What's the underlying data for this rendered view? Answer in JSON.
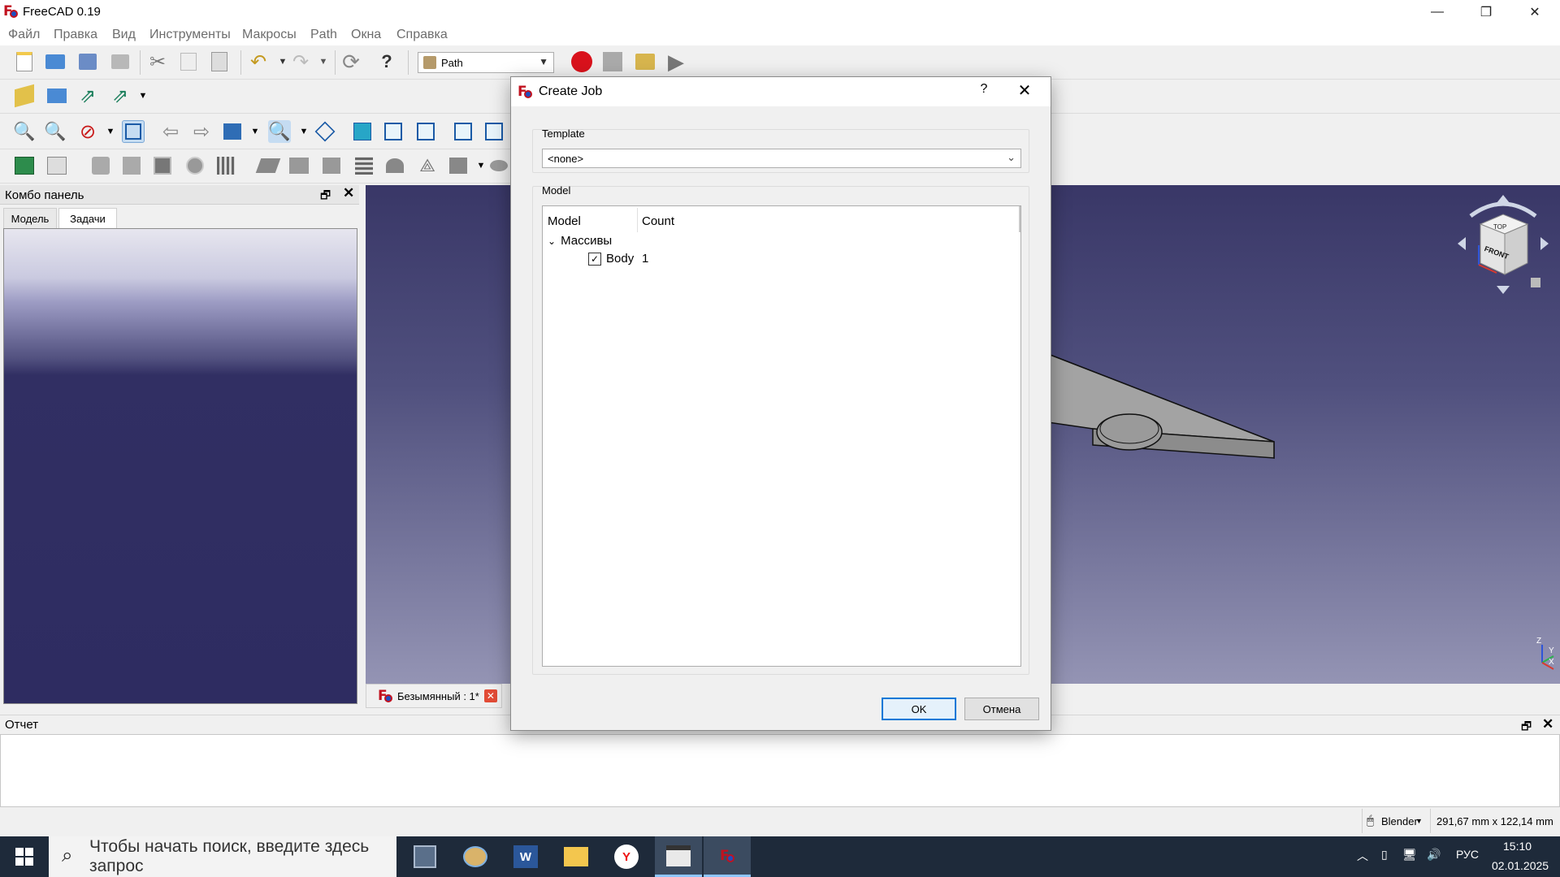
{
  "window": {
    "title": "FreeCAD 0.19",
    "minimize": "—",
    "restore": "❐",
    "close": "✕"
  },
  "menu": [
    "Файл",
    "Правка",
    "Вид",
    "Инструменты",
    "Макросы",
    "Path",
    "Окна",
    "Справка"
  ],
  "toolbar": {
    "workbench": "Path"
  },
  "combo_panel": {
    "title": "Комбо панель",
    "tabs": [
      "Модель",
      "Задачи"
    ],
    "active_tab": "Задачи"
  },
  "document_tab": {
    "label": "Безымянный : 1*"
  },
  "report": {
    "title": "Отчет"
  },
  "status": {
    "nav_style": "Blender",
    "dimensions": "291,67 mm x 122,14 mm"
  },
  "taskbar": {
    "search_placeholder": "Чтобы начать поиск, введите здесь запрос",
    "language": "РУС",
    "time": "15:10",
    "date": "02.01.2025"
  },
  "dialog": {
    "title": "Create Job",
    "help": "?",
    "template_label": "Template",
    "template_value": "<none>",
    "model_label": "Model",
    "columns": [
      "Model",
      "Count"
    ],
    "tree": {
      "group": "Массивы",
      "item": "Body",
      "count": "1",
      "checked": true
    },
    "ok": "OK",
    "cancel": "Отмена"
  },
  "navcube": {
    "top_label": "TOP",
    "front_label": "FRONT"
  },
  "axis": {
    "z": "Z",
    "y": "Y",
    "x": "X"
  }
}
